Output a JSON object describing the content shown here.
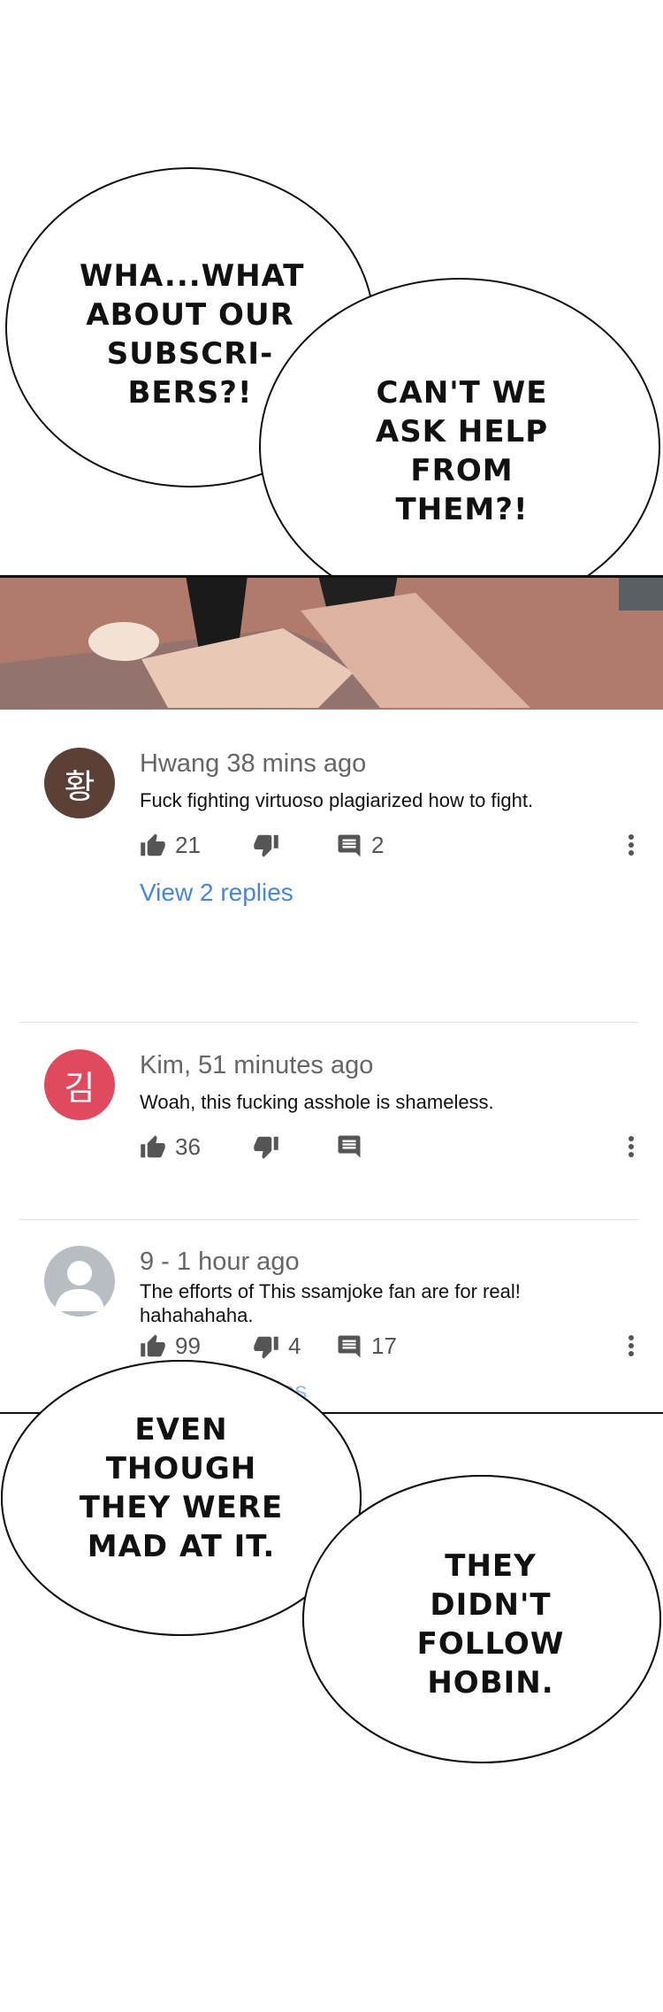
{
  "bubbles": {
    "b1": "WHA...WHAT ABOUT OUR SUBSCRI-BERS?!",
    "b2": "CAN'T WE ASK HELP FROM THEM?!",
    "b3": "EVEN THOUGH THEY WERE MAD AT IT.",
    "b4": "THEY DIDN'T FOLLOW HOBIN."
  },
  "comments": [
    {
      "avatar_char": "황",
      "avatar_color": "#5a4036",
      "header": "Hwang 38 mins ago",
      "text": "Fuck fighting virtuoso plagiarized how to fight.",
      "likes": "21",
      "dislikes": "",
      "reply_count": "2",
      "view_replies": "View 2 replies"
    },
    {
      "avatar_char": "김",
      "avatar_color": "#e04a5f",
      "header": "Kim, 51 minutes ago",
      "text": "Woah, this fucking asshole is shameless.",
      "likes": "36",
      "dislikes": "",
      "reply_count": "",
      "view_replies": ""
    },
    {
      "avatar_char": "",
      "avatar_color": "#b8bcc3",
      "header": "9 - 1 hour ago",
      "text": "The efforts of This ssamjoke fan are for real! hahahahaha.",
      "likes": "99",
      "dislikes": "4",
      "reply_count": "17",
      "view_replies": "View 17 replies"
    }
  ],
  "icons": [
    "thumbs-up-icon",
    "thumbs-down-icon",
    "comment-icon",
    "more-vertical-icon",
    "user-silhouette-icon"
  ],
  "colors": {
    "link": "#4a85d8",
    "meta": "#666666"
  }
}
